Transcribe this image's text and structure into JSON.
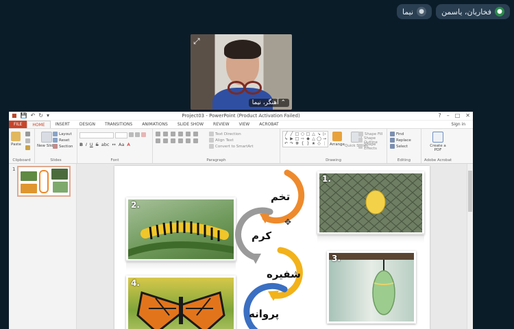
{
  "meeting": {
    "participants": [
      {
        "name": "نیما",
        "mic": "muted"
      },
      {
        "name": "فخاریان، یاسمن",
        "mic": "active"
      }
    ],
    "video_tile": {
      "name": "آهنگر، نیما"
    }
  },
  "app": {
    "window_title": "Project03 - PowerPoint (Product Activation Failed)",
    "sign_in": "Sign in",
    "tabs": [
      "FILE",
      "HOME",
      "INSERT",
      "DESIGN",
      "TRANSITIONS",
      "ANIMATIONS",
      "SLIDE SHOW",
      "REVIEW",
      "VIEW",
      "ACROBAT"
    ],
    "active_tab": "HOME",
    "ribbon": {
      "clipboard": {
        "label": "Clipboard",
        "paste": "Paste"
      },
      "slides": {
        "label": "Slides",
        "new_slide": "New Slide",
        "layout": "Layout",
        "reset": "Reset",
        "section": "Section"
      },
      "font": {
        "label": "Font",
        "bold": "B",
        "italic": "I",
        "underline": "U",
        "strike": "S",
        "shadow": "abc"
      },
      "paragraph": {
        "label": "Paragraph",
        "text_direction": "Text Direction",
        "align_text": "Align Text",
        "smartart": "Convert to SmartArt"
      },
      "drawing": {
        "label": "Drawing",
        "arrange": "Arrange",
        "quick_styles": "Quick Styles",
        "shape_fill": "Shape Fill",
        "shape_outline": "Shape Outline",
        "shape_effects": "Shape Effects"
      },
      "editing": {
        "label": "Editing",
        "find": "Find",
        "replace": "Replace",
        "select": "Select"
      },
      "adobe": {
        "label": "Adobe Acrobat",
        "create_pdf": "Create a PDF"
      }
    },
    "thumbnail_number": "1"
  },
  "slide": {
    "photos": [
      {
        "num": "1.",
        "subject": "egg on leaf"
      },
      {
        "num": "2.",
        "subject": "caterpillar"
      },
      {
        "num": "3.",
        "subject": "chrysalis"
      },
      {
        "num": "4.",
        "subject": "butterfly"
      }
    ],
    "cycle_words": [
      "تخم",
      "کرم",
      "شفیره",
      "پروانه"
    ],
    "colors": {
      "orange": "#ee8a2c",
      "gray": "#9a9a9a",
      "yellow": "#f2b21a",
      "blue": "#3a6fc2"
    }
  }
}
